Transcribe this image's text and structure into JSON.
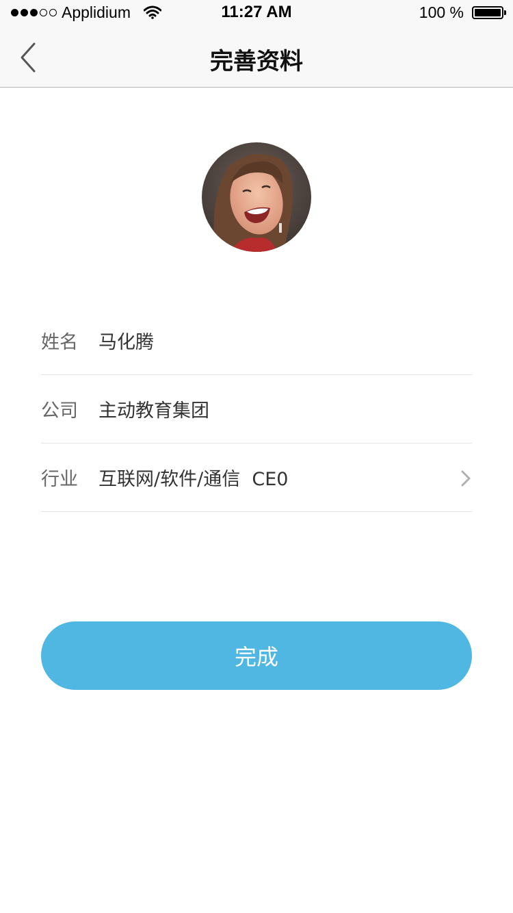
{
  "status_bar": {
    "carrier": "Applidium",
    "time": "11:27 AM",
    "battery": "100 %",
    "signal_strength": 3,
    "signal_max": 5,
    "icons": [
      "wifi-icon",
      "battery-icon"
    ]
  },
  "nav": {
    "title": "完善资料",
    "back_icon": "chevron-left-icon"
  },
  "profile": {
    "avatar": "avatar-photo"
  },
  "form": {
    "rows": [
      {
        "label": "姓名",
        "value": "马化腾"
      },
      {
        "label": "公司",
        "value": "主动教育集团"
      },
      {
        "label": "行业",
        "value": "互联网/软件/通信  CE0",
        "icon": "chevron-right-icon"
      }
    ]
  },
  "actions": {
    "done_label": "完成",
    "button_color": "#50b6e2"
  }
}
